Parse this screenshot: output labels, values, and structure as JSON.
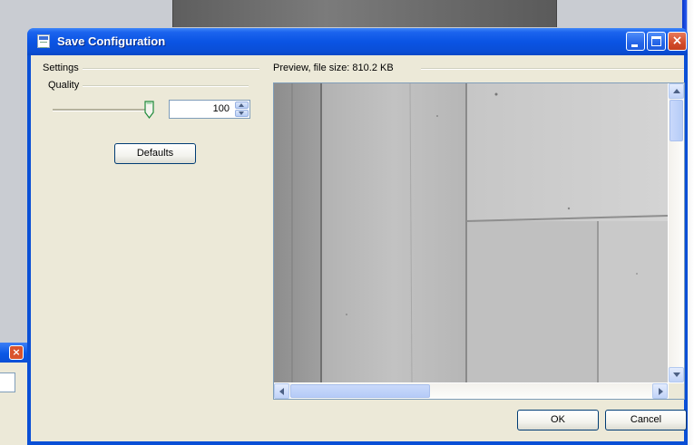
{
  "window": {
    "title": "Save Configuration"
  },
  "settings": {
    "group_label": "Settings",
    "quality_label": "Quality",
    "quality_value": "100",
    "quality_slider_fraction": 1.0,
    "defaults_label": "Defaults"
  },
  "preview": {
    "label": "Preview, file size: 810.2 KB",
    "vertical_scroll_fraction": 0.0,
    "horizontal_scroll_fraction": 0.0
  },
  "footer": {
    "ok_label": "OK",
    "cancel_label": "Cancel"
  },
  "icons": {
    "title": "save-config-icon",
    "minimize": "minimize-icon",
    "maximize": "maximize-icon",
    "close": "close-icon",
    "spin_up": "spin-up-icon",
    "spin_down": "spin-down-icon"
  },
  "colors": {
    "titlebar": "#0a54e4",
    "dialog_face": "#ece9d8",
    "close_button": "#d24c2a"
  }
}
